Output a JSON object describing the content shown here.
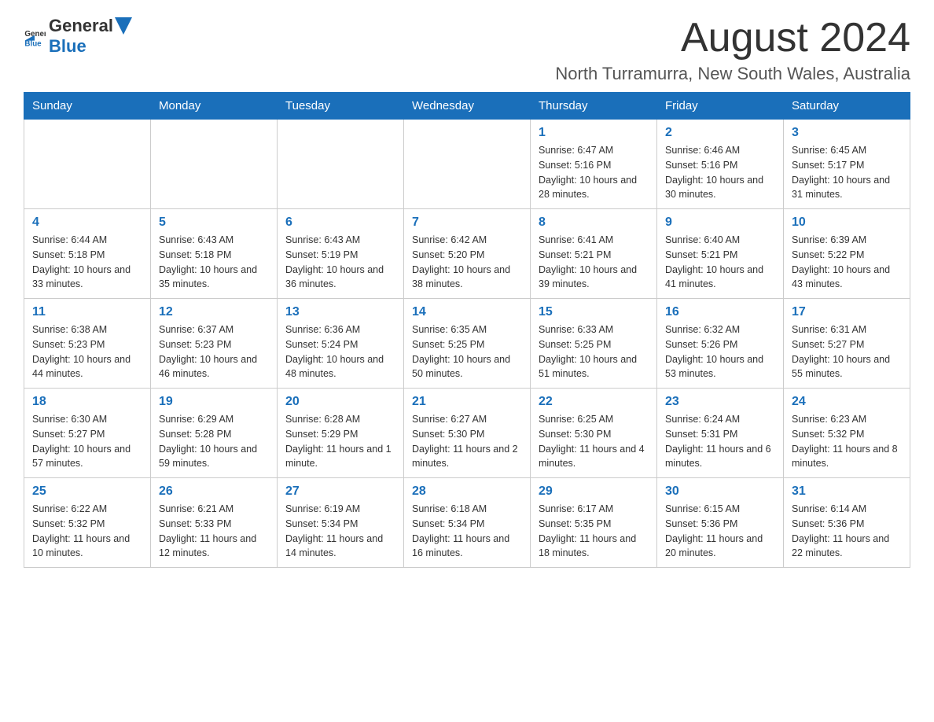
{
  "header": {
    "logo_general": "General",
    "logo_blue": "Blue",
    "month_title": "August 2024",
    "location": "North Turramurra, New South Wales, Australia"
  },
  "weekdays": [
    "Sunday",
    "Monday",
    "Tuesday",
    "Wednesday",
    "Thursday",
    "Friday",
    "Saturday"
  ],
  "weeks": [
    [
      {
        "day": "",
        "info": ""
      },
      {
        "day": "",
        "info": ""
      },
      {
        "day": "",
        "info": ""
      },
      {
        "day": "",
        "info": ""
      },
      {
        "day": "1",
        "info": "Sunrise: 6:47 AM\nSunset: 5:16 PM\nDaylight: 10 hours and 28 minutes."
      },
      {
        "day": "2",
        "info": "Sunrise: 6:46 AM\nSunset: 5:16 PM\nDaylight: 10 hours and 30 minutes."
      },
      {
        "day": "3",
        "info": "Sunrise: 6:45 AM\nSunset: 5:17 PM\nDaylight: 10 hours and 31 minutes."
      }
    ],
    [
      {
        "day": "4",
        "info": "Sunrise: 6:44 AM\nSunset: 5:18 PM\nDaylight: 10 hours and 33 minutes."
      },
      {
        "day": "5",
        "info": "Sunrise: 6:43 AM\nSunset: 5:18 PM\nDaylight: 10 hours and 35 minutes."
      },
      {
        "day": "6",
        "info": "Sunrise: 6:43 AM\nSunset: 5:19 PM\nDaylight: 10 hours and 36 minutes."
      },
      {
        "day": "7",
        "info": "Sunrise: 6:42 AM\nSunset: 5:20 PM\nDaylight: 10 hours and 38 minutes."
      },
      {
        "day": "8",
        "info": "Sunrise: 6:41 AM\nSunset: 5:21 PM\nDaylight: 10 hours and 39 minutes."
      },
      {
        "day": "9",
        "info": "Sunrise: 6:40 AM\nSunset: 5:21 PM\nDaylight: 10 hours and 41 minutes."
      },
      {
        "day": "10",
        "info": "Sunrise: 6:39 AM\nSunset: 5:22 PM\nDaylight: 10 hours and 43 minutes."
      }
    ],
    [
      {
        "day": "11",
        "info": "Sunrise: 6:38 AM\nSunset: 5:23 PM\nDaylight: 10 hours and 44 minutes."
      },
      {
        "day": "12",
        "info": "Sunrise: 6:37 AM\nSunset: 5:23 PM\nDaylight: 10 hours and 46 minutes."
      },
      {
        "day": "13",
        "info": "Sunrise: 6:36 AM\nSunset: 5:24 PM\nDaylight: 10 hours and 48 minutes."
      },
      {
        "day": "14",
        "info": "Sunrise: 6:35 AM\nSunset: 5:25 PM\nDaylight: 10 hours and 50 minutes."
      },
      {
        "day": "15",
        "info": "Sunrise: 6:33 AM\nSunset: 5:25 PM\nDaylight: 10 hours and 51 minutes."
      },
      {
        "day": "16",
        "info": "Sunrise: 6:32 AM\nSunset: 5:26 PM\nDaylight: 10 hours and 53 minutes."
      },
      {
        "day": "17",
        "info": "Sunrise: 6:31 AM\nSunset: 5:27 PM\nDaylight: 10 hours and 55 minutes."
      }
    ],
    [
      {
        "day": "18",
        "info": "Sunrise: 6:30 AM\nSunset: 5:27 PM\nDaylight: 10 hours and 57 minutes."
      },
      {
        "day": "19",
        "info": "Sunrise: 6:29 AM\nSunset: 5:28 PM\nDaylight: 10 hours and 59 minutes."
      },
      {
        "day": "20",
        "info": "Sunrise: 6:28 AM\nSunset: 5:29 PM\nDaylight: 11 hours and 1 minute."
      },
      {
        "day": "21",
        "info": "Sunrise: 6:27 AM\nSunset: 5:30 PM\nDaylight: 11 hours and 2 minutes."
      },
      {
        "day": "22",
        "info": "Sunrise: 6:25 AM\nSunset: 5:30 PM\nDaylight: 11 hours and 4 minutes."
      },
      {
        "day": "23",
        "info": "Sunrise: 6:24 AM\nSunset: 5:31 PM\nDaylight: 11 hours and 6 minutes."
      },
      {
        "day": "24",
        "info": "Sunrise: 6:23 AM\nSunset: 5:32 PM\nDaylight: 11 hours and 8 minutes."
      }
    ],
    [
      {
        "day": "25",
        "info": "Sunrise: 6:22 AM\nSunset: 5:32 PM\nDaylight: 11 hours and 10 minutes."
      },
      {
        "day": "26",
        "info": "Sunrise: 6:21 AM\nSunset: 5:33 PM\nDaylight: 11 hours and 12 minutes."
      },
      {
        "day": "27",
        "info": "Sunrise: 6:19 AM\nSunset: 5:34 PM\nDaylight: 11 hours and 14 minutes."
      },
      {
        "day": "28",
        "info": "Sunrise: 6:18 AM\nSunset: 5:34 PM\nDaylight: 11 hours and 16 minutes."
      },
      {
        "day": "29",
        "info": "Sunrise: 6:17 AM\nSunset: 5:35 PM\nDaylight: 11 hours and 18 minutes."
      },
      {
        "day": "30",
        "info": "Sunrise: 6:15 AM\nSunset: 5:36 PM\nDaylight: 11 hours and 20 minutes."
      },
      {
        "day": "31",
        "info": "Sunrise: 6:14 AM\nSunset: 5:36 PM\nDaylight: 11 hours and 22 minutes."
      }
    ]
  ]
}
